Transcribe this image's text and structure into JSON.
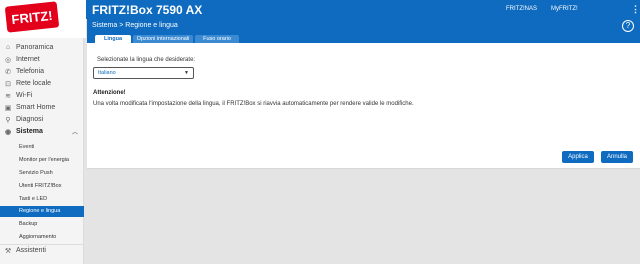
{
  "header": {
    "logo_text": "FRITZ!",
    "product": "FRITZ!Box 7590 AX",
    "links": [
      "FRITZ!NAS",
      "MyFRITZ!"
    ]
  },
  "breadcrumb": "Sistema > Regione e lingua",
  "tabs": [
    "Lingua",
    "Opzioni internazionali",
    "Fuso orario"
  ],
  "sidebar": {
    "items": [
      {
        "label": "Panoramica",
        "icon": "home-icon"
      },
      {
        "label": "Internet",
        "icon": "globe-icon"
      },
      {
        "label": "Telefonia",
        "icon": "phone-icon"
      },
      {
        "label": "Rete locale",
        "icon": "network-icon"
      },
      {
        "label": "Wi-Fi",
        "icon": "wifi-icon"
      },
      {
        "label": "Smart Home",
        "icon": "smarthome-icon"
      },
      {
        "label": "Diagnosi",
        "icon": "diagnosis-icon"
      },
      {
        "label": "Sistema",
        "icon": "system-icon"
      }
    ],
    "subitems": [
      "Eventi",
      "Monitor per l'energia",
      "Servizio Push",
      "Utenti FRITZ!Box",
      "Tasti e LED",
      "Regione e lingua",
      "Backup",
      "Aggiornamento"
    ],
    "assistants": "Assistenti"
  },
  "content": {
    "field_label": "Selezionate la lingua che desiderate:",
    "select_value": "Italiano",
    "warning_title": "Attenzione!",
    "warning_text": "Una volta modificata l'impostazione della lingua, il FRITZ!Box si riavvia automaticamente per rendere valide le modifiche."
  },
  "buttons": {
    "apply": "Applica",
    "cancel": "Annulla"
  },
  "colors": {
    "brand_blue": "#0e6bc0",
    "logo_red": "#e3001b"
  }
}
